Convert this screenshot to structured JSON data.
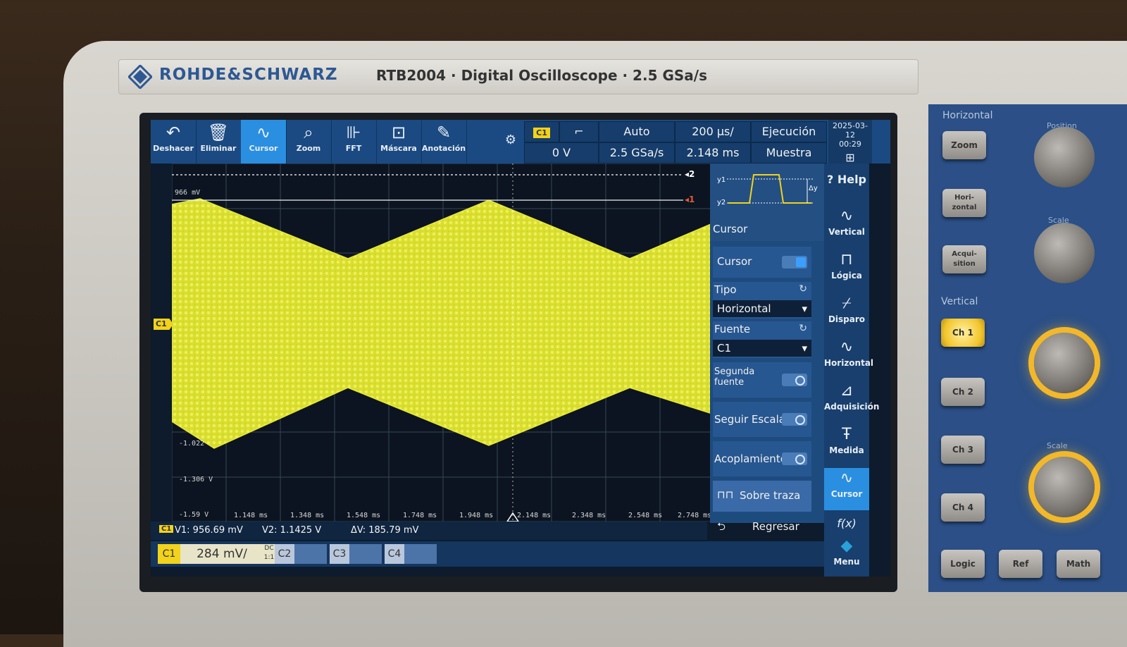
{
  "brand": {
    "name": "ROHDE&SCHWARZ",
    "model": "RTB2004 · Digital Oscilloscope · 2.5 GSa/s"
  },
  "toolbar": {
    "tools": [
      {
        "label": "Deshacer",
        "icon": "↶"
      },
      {
        "label": "Eliminar",
        "icon": "🗑"
      },
      {
        "label": "Cursor",
        "icon": "∿"
      },
      {
        "label": "Zoom",
        "icon": "⌕"
      },
      {
        "label": "FFT",
        "icon": "⊪"
      },
      {
        "label": "Máscara",
        "icon": "⊡"
      },
      {
        "label": "Anotación",
        "icon": "✎"
      }
    ],
    "trigger_channel": "C1",
    "trigger_slope_icon": "⌐",
    "trigger_mode": "Auto",
    "timebase": "200 µs/",
    "run_state": "Ejecución",
    "trigger_level": "0 V",
    "sample_rate": "2.5 GSa/s",
    "h_position": "2.148 ms",
    "acq_mode": "Muestra",
    "date": "2025-03-12",
    "time": "00:29"
  },
  "plot": {
    "y_labels": [
      "966 mV",
      "-1.022",
      "-1.306 V",
      "-1.59 V"
    ],
    "x_labels": [
      "1.148 ms",
      "1.348 ms",
      "1.548 ms",
      "1.748 ms",
      "1.948 ms",
      "2.148 ms",
      "2.348 ms",
      "2.548 ms",
      "2.748 ms"
    ],
    "cursor_marks": [
      "◂2",
      "◂1"
    ],
    "channel_marker": "C1",
    "trace_color": "#e8e83a",
    "cursor_color": "#e05a3a"
  },
  "side_menu": {
    "title": "Cursor",
    "diagram_y1": "y1",
    "diagram_y2": "y2",
    "diagram_dy": "Δy",
    "cursor_label": "Cursor",
    "tipo_label": "Tipo",
    "tipo_value": "Horizontal",
    "fuente_label": "Fuente",
    "fuente_value": "C1",
    "segunda_fuente": "Segunda fuente",
    "seguir_escala": "Seguir Escala",
    "acoplamiento": "Acoplamiento",
    "sobre_traza": "Sobre traza",
    "regresar": "Regresar"
  },
  "right_menu": [
    {
      "label": "Help",
      "icon": "?"
    },
    {
      "label": "Vertical",
      "icon": "∿"
    },
    {
      "label": "Lógica",
      "icon": "⊓"
    },
    {
      "label": "Disparo",
      "icon": "⌿"
    },
    {
      "label": "Horizontal",
      "icon": "∿"
    },
    {
      "label": "Adquisición",
      "icon": "⊿"
    },
    {
      "label": "Medida",
      "icon": "Ŧ"
    },
    {
      "label": "Cursor",
      "icon": "∿"
    },
    {
      "label": "",
      "icon": "f(x)"
    },
    {
      "label": "Menu",
      "icon": "◆"
    }
  ],
  "measurements": {
    "channel": "C1",
    "v1": "V1: 956.69 mV",
    "v2": "V2: 1.1425 V",
    "dv": "ΔV: 185.79 mV"
  },
  "channels": {
    "c1": "C1",
    "c1_scale": "284 mV/",
    "c1_coupling": "DC",
    "c1_ratio": "1:1",
    "c2": "C2",
    "c3": "C3",
    "c4": "C4"
  },
  "panel": {
    "horizontal": "Horizontal",
    "position": "Position",
    "scale": "Scale",
    "zoom": "Zoom",
    "horizontal_btn": "Hori-zontal",
    "acquisition": "Acqui-sition",
    "vertical": "Vertical",
    "ch1": "Ch 1",
    "ch2": "Ch 2",
    "ch3": "Ch 3",
    "ch4": "Ch 4",
    "logic": "Logic",
    "ref": "Ref",
    "math": "Math"
  }
}
